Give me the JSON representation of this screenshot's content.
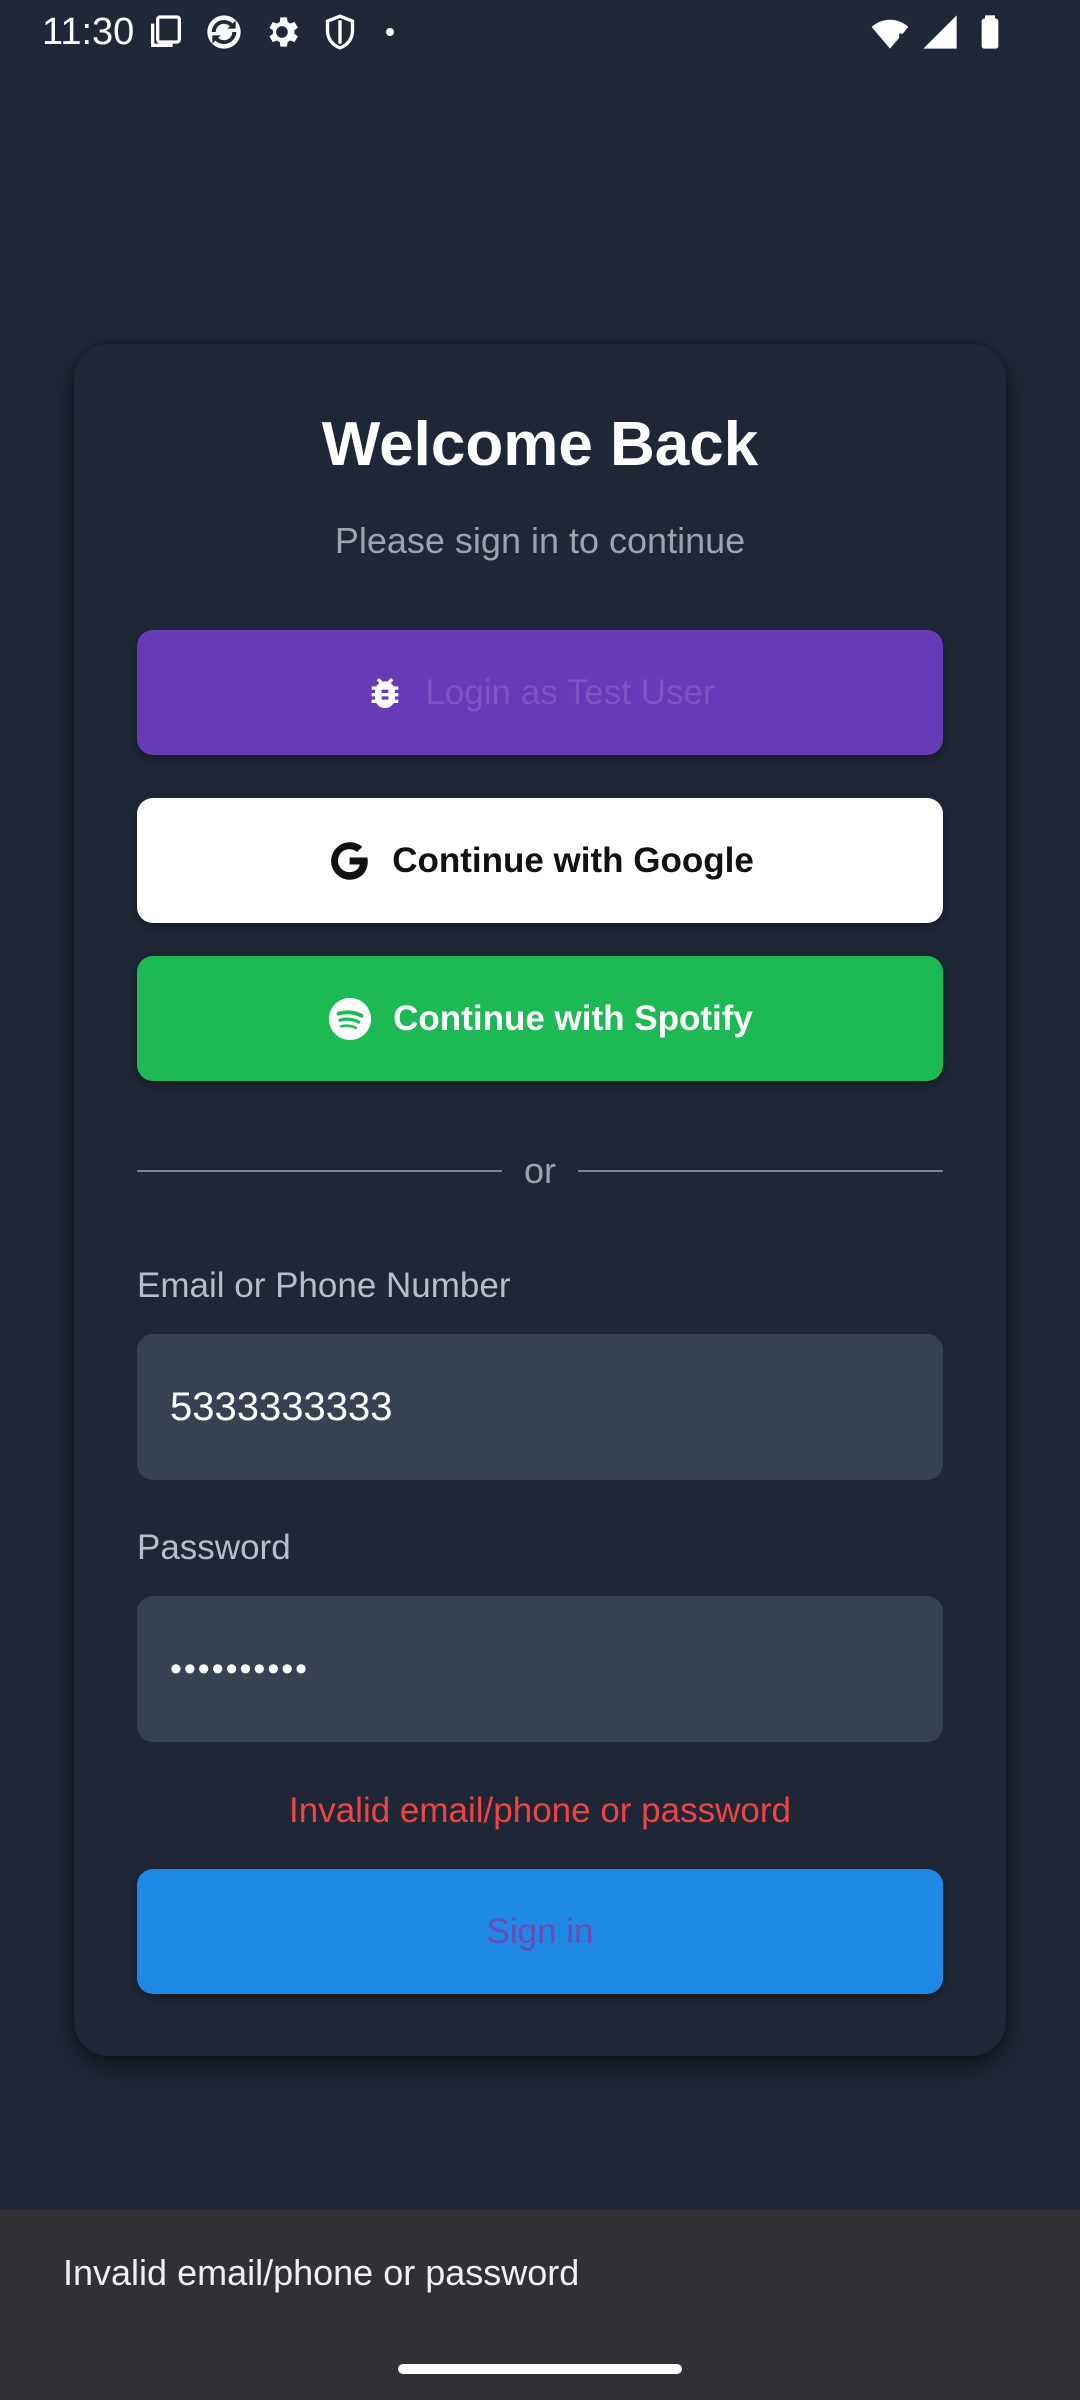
{
  "status_bar": {
    "time": "11:30",
    "left_icons": [
      "screenshot-icon",
      "sync-icon",
      "settings-icon",
      "shield-icon",
      "dot-icon"
    ],
    "right_icons": [
      "wifi-icon",
      "signal-icon",
      "battery-icon"
    ]
  },
  "login": {
    "title": "Welcome Back",
    "subtitle": "Please sign in to continue",
    "test_user_label": "Login as Test User",
    "google_label": "Continue with Google",
    "spotify_label": "Continue with Spotify",
    "divider_text": "or",
    "email_label": "Email or Phone Number",
    "email_value": "5333333333",
    "password_label": "Password",
    "password_value": "••••••••••",
    "error_message": "Invalid email/phone or password",
    "sign_in_label": "Sign in"
  },
  "snackbar": {
    "message": "Invalid email/phone or password"
  },
  "colors": {
    "background": "#202838",
    "card": "#1f2737",
    "test_user_button": "#673ab7",
    "google_button": "#ffffff",
    "spotify_button": "#1db954",
    "sign_in_button": "#1e88e5",
    "error": "#ef4444",
    "input_fill": "#384152"
  }
}
